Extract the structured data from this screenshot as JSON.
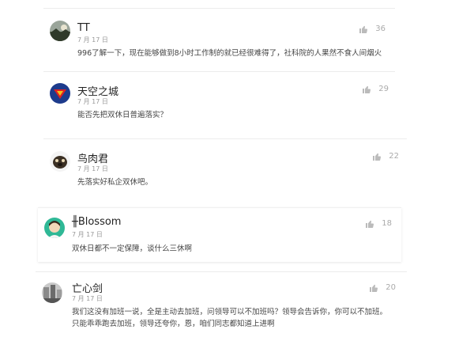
{
  "comments": [
    {
      "user": "TT",
      "date": "7 月 17 日",
      "text": [
        "996了解一下，现在能够做到8小时工作制的就已经很难得了，社科院的人果然不食人间烟火"
      ],
      "likes": "36",
      "avatar": "landscape"
    },
    {
      "user": "天空之城",
      "date": "7 月 17 日",
      "text": [
        "能否先把双休日普遍落实？"
      ],
      "likes": "29",
      "avatar": "superman-logo"
    },
    {
      "user": "鸟肉君",
      "date": "7 月 17 日",
      "text": [
        "先落实好私企双休吧。"
      ],
      "likes": "22",
      "avatar": "dog"
    },
    {
      "user": "╫Blossom",
      "date": "7 月 17 日",
      "text": [
        "双休日都不一定保障，谈什么三休啊"
      ],
      "likes": "18",
      "avatar": "girl"
    },
    {
      "user": "亡心剑",
      "date": "7 月 17 日",
      "text": [
        "我们这没有加班一说，全是主动去加班，问领导可以不加班吗？领导会告诉你，你可以不加班。",
        "只能乖乖跑去加班，领导还夸你，恩，咱们同志都知道上进啊"
      ],
      "likes": "20",
      "avatar": "street"
    }
  ],
  "colors": {
    "like": "#bbbbbb",
    "date": "#999999",
    "text": "#444444"
  }
}
